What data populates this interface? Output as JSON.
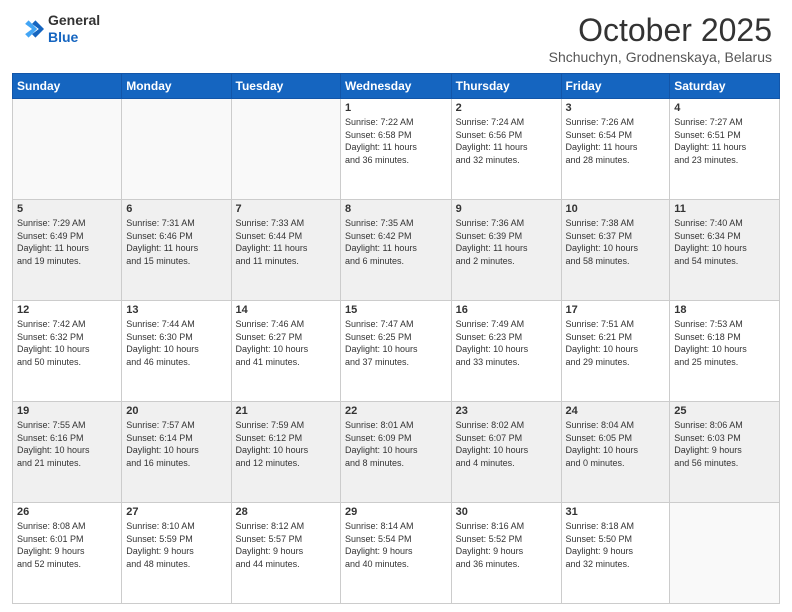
{
  "header": {
    "logo_general": "General",
    "logo_blue": "Blue",
    "month": "October 2025",
    "location": "Shchuchyn, Grodnenskaya, Belarus"
  },
  "days_of_week": [
    "Sunday",
    "Monday",
    "Tuesday",
    "Wednesday",
    "Thursday",
    "Friday",
    "Saturday"
  ],
  "weeks": [
    [
      {
        "day": "",
        "info": ""
      },
      {
        "day": "",
        "info": ""
      },
      {
        "day": "",
        "info": ""
      },
      {
        "day": "1",
        "info": "Sunrise: 7:22 AM\nSunset: 6:58 PM\nDaylight: 11 hours\nand 36 minutes."
      },
      {
        "day": "2",
        "info": "Sunrise: 7:24 AM\nSunset: 6:56 PM\nDaylight: 11 hours\nand 32 minutes."
      },
      {
        "day": "3",
        "info": "Sunrise: 7:26 AM\nSunset: 6:54 PM\nDaylight: 11 hours\nand 28 minutes."
      },
      {
        "day": "4",
        "info": "Sunrise: 7:27 AM\nSunset: 6:51 PM\nDaylight: 11 hours\nand 23 minutes."
      }
    ],
    [
      {
        "day": "5",
        "info": "Sunrise: 7:29 AM\nSunset: 6:49 PM\nDaylight: 11 hours\nand 19 minutes."
      },
      {
        "day": "6",
        "info": "Sunrise: 7:31 AM\nSunset: 6:46 PM\nDaylight: 11 hours\nand 15 minutes."
      },
      {
        "day": "7",
        "info": "Sunrise: 7:33 AM\nSunset: 6:44 PM\nDaylight: 11 hours\nand 11 minutes."
      },
      {
        "day": "8",
        "info": "Sunrise: 7:35 AM\nSunset: 6:42 PM\nDaylight: 11 hours\nand 6 minutes."
      },
      {
        "day": "9",
        "info": "Sunrise: 7:36 AM\nSunset: 6:39 PM\nDaylight: 11 hours\nand 2 minutes."
      },
      {
        "day": "10",
        "info": "Sunrise: 7:38 AM\nSunset: 6:37 PM\nDaylight: 10 hours\nand 58 minutes."
      },
      {
        "day": "11",
        "info": "Sunrise: 7:40 AM\nSunset: 6:34 PM\nDaylight: 10 hours\nand 54 minutes."
      }
    ],
    [
      {
        "day": "12",
        "info": "Sunrise: 7:42 AM\nSunset: 6:32 PM\nDaylight: 10 hours\nand 50 minutes."
      },
      {
        "day": "13",
        "info": "Sunrise: 7:44 AM\nSunset: 6:30 PM\nDaylight: 10 hours\nand 46 minutes."
      },
      {
        "day": "14",
        "info": "Sunrise: 7:46 AM\nSunset: 6:27 PM\nDaylight: 10 hours\nand 41 minutes."
      },
      {
        "day": "15",
        "info": "Sunrise: 7:47 AM\nSunset: 6:25 PM\nDaylight: 10 hours\nand 37 minutes."
      },
      {
        "day": "16",
        "info": "Sunrise: 7:49 AM\nSunset: 6:23 PM\nDaylight: 10 hours\nand 33 minutes."
      },
      {
        "day": "17",
        "info": "Sunrise: 7:51 AM\nSunset: 6:21 PM\nDaylight: 10 hours\nand 29 minutes."
      },
      {
        "day": "18",
        "info": "Sunrise: 7:53 AM\nSunset: 6:18 PM\nDaylight: 10 hours\nand 25 minutes."
      }
    ],
    [
      {
        "day": "19",
        "info": "Sunrise: 7:55 AM\nSunset: 6:16 PM\nDaylight: 10 hours\nand 21 minutes."
      },
      {
        "day": "20",
        "info": "Sunrise: 7:57 AM\nSunset: 6:14 PM\nDaylight: 10 hours\nand 16 minutes."
      },
      {
        "day": "21",
        "info": "Sunrise: 7:59 AM\nSunset: 6:12 PM\nDaylight: 10 hours\nand 12 minutes."
      },
      {
        "day": "22",
        "info": "Sunrise: 8:01 AM\nSunset: 6:09 PM\nDaylight: 10 hours\nand 8 minutes."
      },
      {
        "day": "23",
        "info": "Sunrise: 8:02 AM\nSunset: 6:07 PM\nDaylight: 10 hours\nand 4 minutes."
      },
      {
        "day": "24",
        "info": "Sunrise: 8:04 AM\nSunset: 6:05 PM\nDaylight: 10 hours\nand 0 minutes."
      },
      {
        "day": "25",
        "info": "Sunrise: 8:06 AM\nSunset: 6:03 PM\nDaylight: 9 hours\nand 56 minutes."
      }
    ],
    [
      {
        "day": "26",
        "info": "Sunrise: 8:08 AM\nSunset: 6:01 PM\nDaylight: 9 hours\nand 52 minutes."
      },
      {
        "day": "27",
        "info": "Sunrise: 8:10 AM\nSunset: 5:59 PM\nDaylight: 9 hours\nand 48 minutes."
      },
      {
        "day": "28",
        "info": "Sunrise: 8:12 AM\nSunset: 5:57 PM\nDaylight: 9 hours\nand 44 minutes."
      },
      {
        "day": "29",
        "info": "Sunrise: 8:14 AM\nSunset: 5:54 PM\nDaylight: 9 hours\nand 40 minutes."
      },
      {
        "day": "30",
        "info": "Sunrise: 8:16 AM\nSunset: 5:52 PM\nDaylight: 9 hours\nand 36 minutes."
      },
      {
        "day": "31",
        "info": "Sunrise: 8:18 AM\nSunset: 5:50 PM\nDaylight: 9 hours\nand 32 minutes."
      },
      {
        "day": "",
        "info": ""
      }
    ]
  ]
}
